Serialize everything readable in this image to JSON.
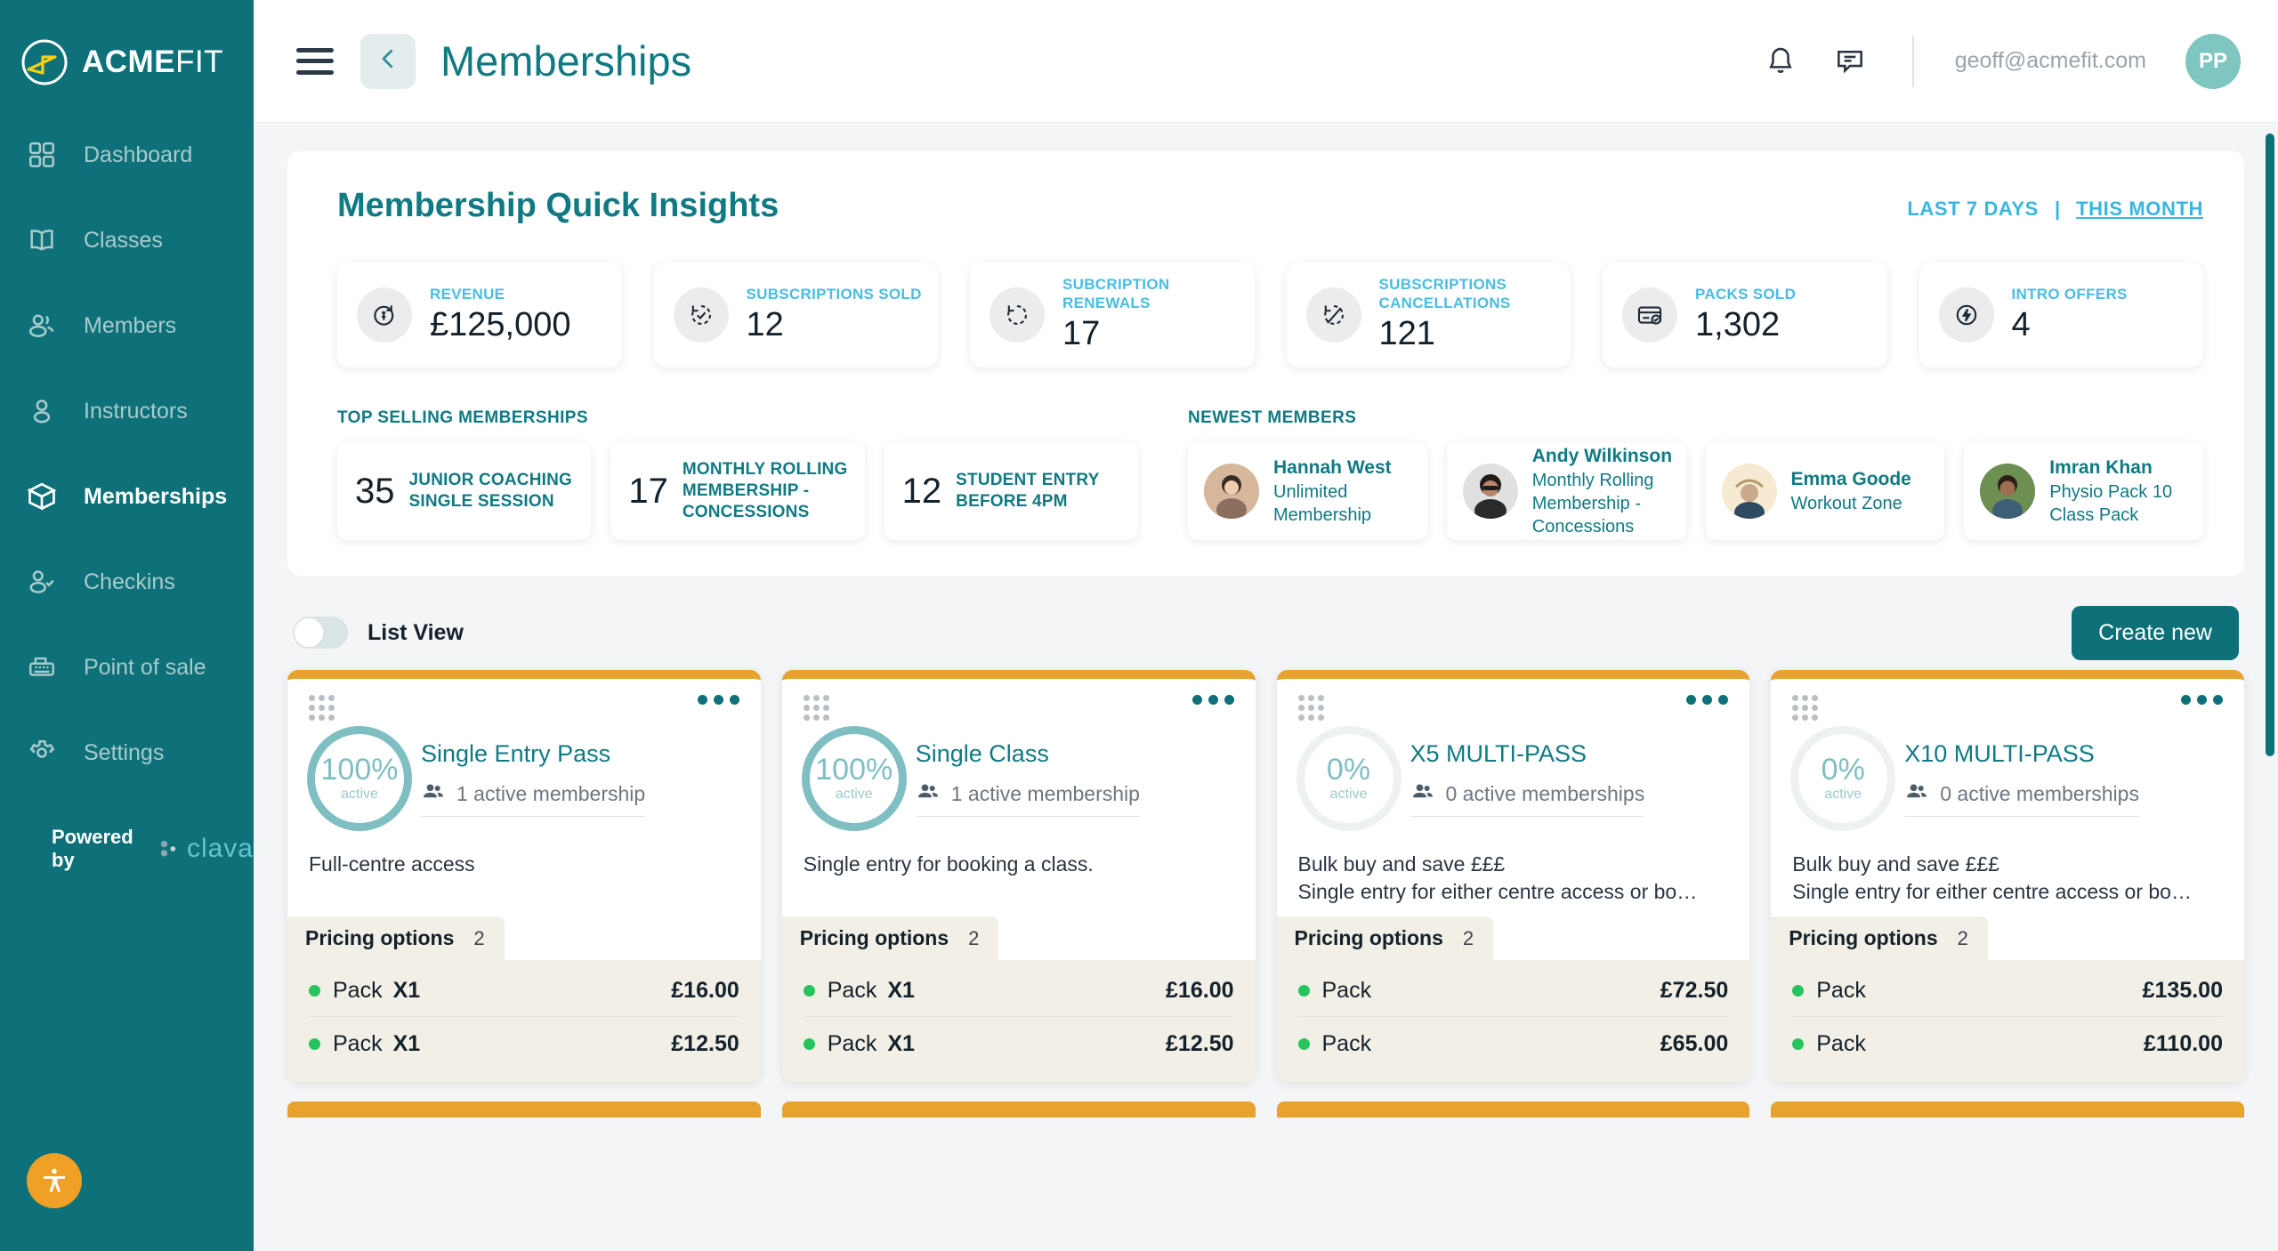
{
  "brand": {
    "name_bold": "ACME",
    "name_light": "FIT",
    "logo_icon": "acmefit-logo-icon"
  },
  "sidebar": {
    "items": [
      {
        "label": "Dashboard",
        "icon": "grid-icon",
        "active": false
      },
      {
        "label": "Classes",
        "icon": "book-icon",
        "active": false
      },
      {
        "label": "Members",
        "icon": "users-icon",
        "active": false
      },
      {
        "label": "Instructors",
        "icon": "user-icon",
        "active": false
      },
      {
        "label": "Memberships",
        "icon": "cube-icon",
        "active": true
      },
      {
        "label": "Checkins",
        "icon": "user-check-icon",
        "active": false
      },
      {
        "label": "Point of sale",
        "icon": "cash-register-icon",
        "active": false
      },
      {
        "label": "Settings",
        "icon": "gear-icon",
        "active": false
      }
    ],
    "powered_by": "Powered by",
    "vendor": "clava",
    "fab_icon": "accessibility-icon"
  },
  "topbar": {
    "menu_icon": "hamburger-icon",
    "back_icon": "chevron-left-icon",
    "title": "Memberships",
    "bell_icon": "bell-icon",
    "chat_icon": "chat-icon",
    "email": "geoff@acmefit.com",
    "avatar_initials": "PP"
  },
  "insights": {
    "title": "Membership Quick Insights",
    "range_options": [
      {
        "label": "LAST 7 DAYS",
        "selected": false
      },
      {
        "label": "THIS MONTH",
        "selected": true
      }
    ],
    "range_separator": "|",
    "metrics": [
      {
        "label": "REVENUE",
        "value": "£125,000",
        "icon": "money-refund-icon"
      },
      {
        "label": "SUBSCRIPTIONS SOLD",
        "value": "12",
        "icon": "subscription-check-icon"
      },
      {
        "label": "SUBCRIPTION RENEWALS",
        "value": "17",
        "icon": "renewal-icon"
      },
      {
        "label": "SUBSCRIPTIONS CANCELLATIONS",
        "value": "121",
        "icon": "cancel-subscription-icon"
      },
      {
        "label": "PACKS SOLD",
        "value": "1,302",
        "icon": "card-check-icon"
      },
      {
        "label": "INTRO OFFERS",
        "value": "4",
        "icon": "lightning-icon"
      }
    ],
    "top_selling": {
      "label": "TOP SELLING MEMBERSHIPS",
      "items": [
        {
          "count": "35",
          "name": "JUNIOR COACHING SINGLE SESSION"
        },
        {
          "count": "17",
          "name": "MONTHLY ROLLING MEMBERSHIP - CONCESSIONS"
        },
        {
          "count": "12",
          "name": "STUDENT ENTRY BEFORE 4PM"
        }
      ]
    },
    "newest_members": {
      "label": "NEWEST MEMBERS",
      "items": [
        {
          "name": "Hannah West",
          "plan": "Unlimited Membership",
          "avatar_color": "#c9a48b"
        },
        {
          "name": "Andy Wilkinson",
          "plan": "Monthly Rolling Membership - Concessions",
          "avatar_color": "#6b6b6b"
        },
        {
          "name": "Emma Goode",
          "plan": "Workout Zone",
          "avatar_color": "#f3e5c8"
        },
        {
          "name": "Imran Khan",
          "plan": "Physio Pack 10 Class Pack",
          "avatar_color": "#5d7f4a"
        }
      ]
    }
  },
  "toolbar": {
    "toggle_label": "List View",
    "toggle_on": false,
    "create_label": "Create new"
  },
  "cards": [
    {
      "percent": "100%",
      "percent_value": 100,
      "percent_sub": "active",
      "title": "Single Entry Pass",
      "active_memberships": "1 active membership",
      "description_lines": [
        "Full-centre access"
      ],
      "pricing_label": "Pricing options",
      "pricing_count": "2",
      "prices": [
        {
          "name": "Pack",
          "qty": "X1",
          "amount": "£16.00"
        },
        {
          "name": "Pack",
          "qty": "X1",
          "amount": "£12.50"
        }
      ]
    },
    {
      "percent": "100%",
      "percent_value": 100,
      "percent_sub": "active",
      "title": "Single Class",
      "active_memberships": "1 active membership",
      "description_lines": [
        "Single entry for booking a class."
      ],
      "pricing_label": "Pricing options",
      "pricing_count": "2",
      "prices": [
        {
          "name": "Pack",
          "qty": "X1",
          "amount": "£16.00"
        },
        {
          "name": "Pack",
          "qty": "X1",
          "amount": "£12.50"
        }
      ]
    },
    {
      "percent": "0%",
      "percent_value": 0,
      "percent_sub": "active",
      "title": "X5 MULTI-PASS",
      "active_memberships": "0 active memberships",
      "description_lines": [
        "Bulk buy and save £££",
        "Single entry for either centre access or bo…"
      ],
      "pricing_label": "Pricing options",
      "pricing_count": "2",
      "prices": [
        {
          "name": "Pack",
          "qty": "",
          "amount": "£72.50"
        },
        {
          "name": "Pack",
          "qty": "",
          "amount": "£65.00"
        }
      ]
    },
    {
      "percent": "0%",
      "percent_value": 0,
      "percent_sub": "active",
      "title": "X10 MULTI-PASS",
      "active_memberships": "0 active memberships",
      "description_lines": [
        "Bulk buy and save £££",
        "Single entry for either centre access or bo…"
      ],
      "pricing_label": "Pricing options",
      "pricing_count": "2",
      "prices": [
        {
          "name": "Pack",
          "qty": "",
          "amount": "£135.00"
        },
        {
          "name": "Pack",
          "qty": "",
          "amount": "£110.00"
        }
      ]
    }
  ],
  "colors": {
    "sidebar": "#0e7078",
    "teal": "#107a82",
    "accent_blue": "#49bde2",
    "card_top": "#e8a22e",
    "green_dot": "#25c45d",
    "ring": "#7fbfc2"
  }
}
